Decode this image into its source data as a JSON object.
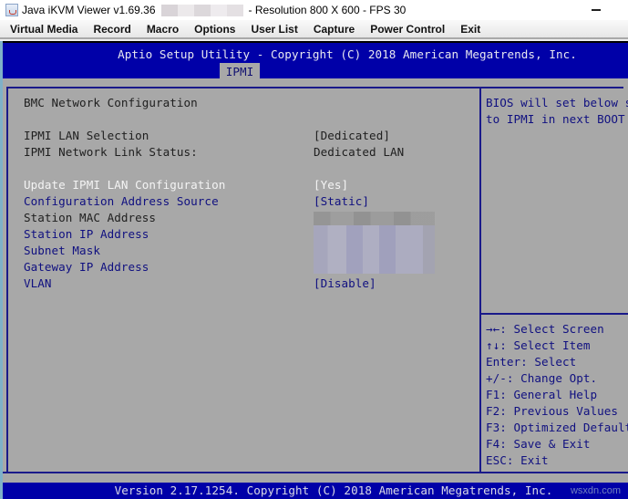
{
  "window": {
    "title_prefix": "Java iKVM Viewer v1.69.36",
    "title_suffix": "- Resolution 800 X 600 - FPS 30"
  },
  "menubar": {
    "items": [
      {
        "label": "Virtual Media"
      },
      {
        "label": "Record"
      },
      {
        "label": "Macro"
      },
      {
        "label": "Options"
      },
      {
        "label": "User List"
      },
      {
        "label": "Capture"
      },
      {
        "label": "Power Control"
      },
      {
        "label": "Exit"
      }
    ]
  },
  "bios": {
    "title": "Aptio Setup Utility - Copyright (C) 2018 American Megatrends, Inc.",
    "active_tab": "IPMI",
    "section_heading": "BMC Network Configuration",
    "settings": [
      {
        "label": "IPMI LAN Selection",
        "value": "[Dedicated]"
      },
      {
        "label": "IPMI Network Link Status:",
        "value": "Dedicated LAN"
      },
      {
        "label": "Update IPMI LAN Configuration",
        "value": "[Yes]"
      },
      {
        "label": "Configuration Address Source",
        "value": "[Static]"
      },
      {
        "label": "Station MAC Address",
        "value": ""
      },
      {
        "label": "Station IP Address",
        "value": ""
      },
      {
        "label": "Subnet Mask",
        "value": ""
      },
      {
        "label": "Gateway IP Address",
        "value": ""
      },
      {
        "label": "VLAN",
        "value": "[Disable]"
      }
    ],
    "help_text": [
      "BIOS will set below s",
      "to IPMI in next BOOT"
    ],
    "key_legend": [
      "→←: Select Screen",
      "↑↓: Select Item",
      "Enter: Select",
      "+/-: Change Opt.",
      "F1: General Help",
      "F2: Previous Values",
      "F3: Optimized Default",
      "F4: Save & Exit",
      "ESC: Exit"
    ],
    "footer": "Version 2.17.1254. Copyright (C) 2018 American Megatrends, Inc."
  },
  "watermark": "wsxdn.com"
}
